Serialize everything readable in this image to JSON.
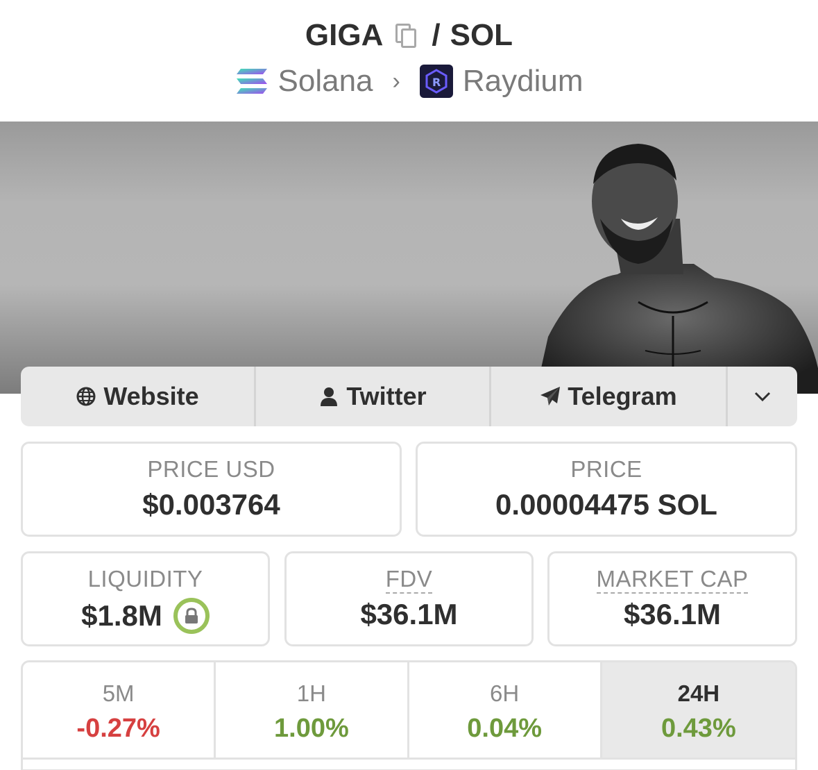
{
  "header": {
    "base_symbol": "GIGA",
    "separator": "/",
    "quote_symbol": "SOL",
    "chain": "Solana",
    "dex": "Raydium"
  },
  "links": {
    "website": "Website",
    "twitter": "Twitter",
    "telegram": "Telegram"
  },
  "prices": {
    "price_usd_label": "PRICE USD",
    "price_usd_value": "$0.003764",
    "price_label": "PRICE",
    "price_value": "0.00004475 SOL"
  },
  "metrics": {
    "liquidity_label": "LIQUIDITY",
    "liquidity_value": "$1.8M",
    "fdv_label": "FDV",
    "fdv_value": "$36.1M",
    "mcap_label": "MARKET CAP",
    "mcap_value": "$36.1M"
  },
  "timeframes": [
    {
      "label": "5M",
      "value": "-0.27%",
      "color": "#d64040"
    },
    {
      "label": "1H",
      "value": "1.00%",
      "color": "#6e9a3c"
    },
    {
      "label": "6H",
      "value": "0.04%",
      "color": "#6e9a3c"
    },
    {
      "label": "24H",
      "value": "0.43%",
      "color": "#6e9a3c"
    }
  ],
  "colors": {
    "positive": "#6e9a3c",
    "negative": "#d64040",
    "lock_ring": "#9ac25a"
  }
}
